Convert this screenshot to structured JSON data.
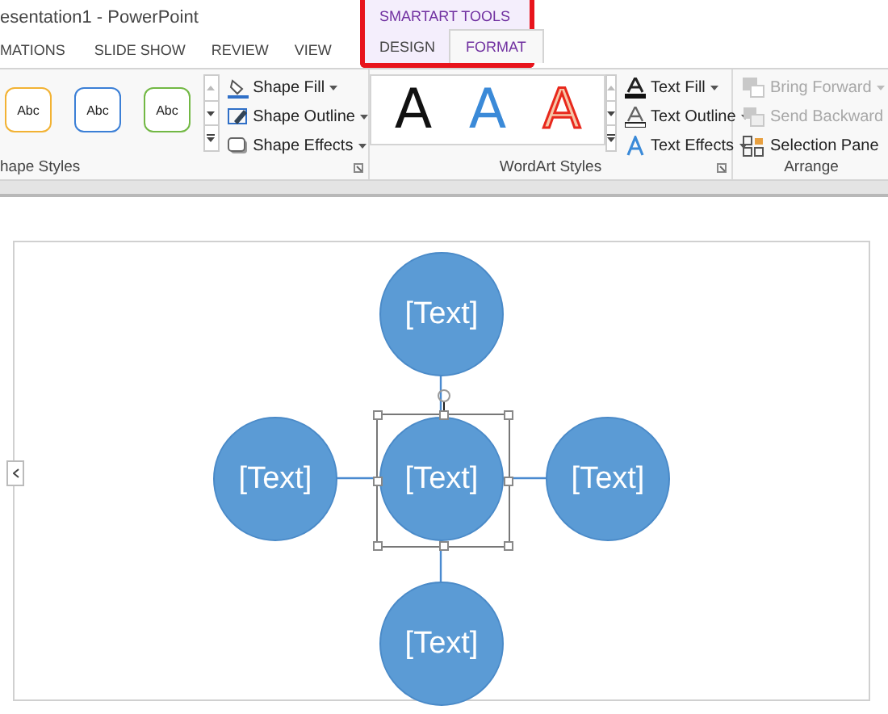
{
  "window": {
    "title": "esentation1 - PowerPoint"
  },
  "contextual_tabs": {
    "label": "SMARTART TOOLS"
  },
  "tabs": [
    {
      "label": "MATIONS",
      "selected": false,
      "contextual": false
    },
    {
      "label": "SLIDE SHOW",
      "selected": false,
      "contextual": false
    },
    {
      "label": "REVIEW",
      "selected": false,
      "contextual": false
    },
    {
      "label": "VIEW",
      "selected": false,
      "contextual": false
    },
    {
      "label": "DESIGN",
      "selected": false,
      "contextual": true
    },
    {
      "label": "FORMAT",
      "selected": true,
      "contextual": true
    }
  ],
  "shape_styles": {
    "label": "hape Styles",
    "gallery": [
      {
        "label": "Abc",
        "color": "#f2b233"
      },
      {
        "label": "Abc",
        "color": "#3b7fd6"
      },
      {
        "label": "Abc",
        "color": "#72b844"
      }
    ],
    "commands": [
      {
        "label": "Shape Fill",
        "kind": "fill"
      },
      {
        "label": "Shape Outline",
        "kind": "outline"
      },
      {
        "label": "Shape Effects",
        "kind": "effects"
      }
    ]
  },
  "wordart_styles": {
    "label": "WordArt Styles",
    "gallery": [
      {
        "label": "A",
        "kind": "plain"
      },
      {
        "label": "A",
        "kind": "blue"
      },
      {
        "label": "A",
        "kind": "outlined"
      }
    ],
    "commands": [
      {
        "label": "Text Fill",
        "kind": "fill"
      },
      {
        "label": "Text Outline",
        "kind": "outline"
      },
      {
        "label": "Text Effects",
        "kind": "effects"
      }
    ]
  },
  "arrange": {
    "label": "Arrange",
    "commands": [
      {
        "label": "Bring Forward",
        "kind": "forward",
        "disabled": true
      },
      {
        "label": "Send Backward",
        "kind": "backward",
        "disabled": true
      },
      {
        "label": "Selection Pane",
        "kind": "pane",
        "disabled": false
      }
    ]
  },
  "smartart": {
    "nodes": [
      {
        "text": "[Text]",
        "kind": "top",
        "selected": false
      },
      {
        "text": "[Text]",
        "kind": "left",
        "selected": false
      },
      {
        "text": "[Text]",
        "kind": "center",
        "selected": true
      },
      {
        "text": "[Text]",
        "kind": "right",
        "selected": false
      },
      {
        "text": "[Text]",
        "kind": "bottom",
        "selected": false
      }
    ]
  }
}
